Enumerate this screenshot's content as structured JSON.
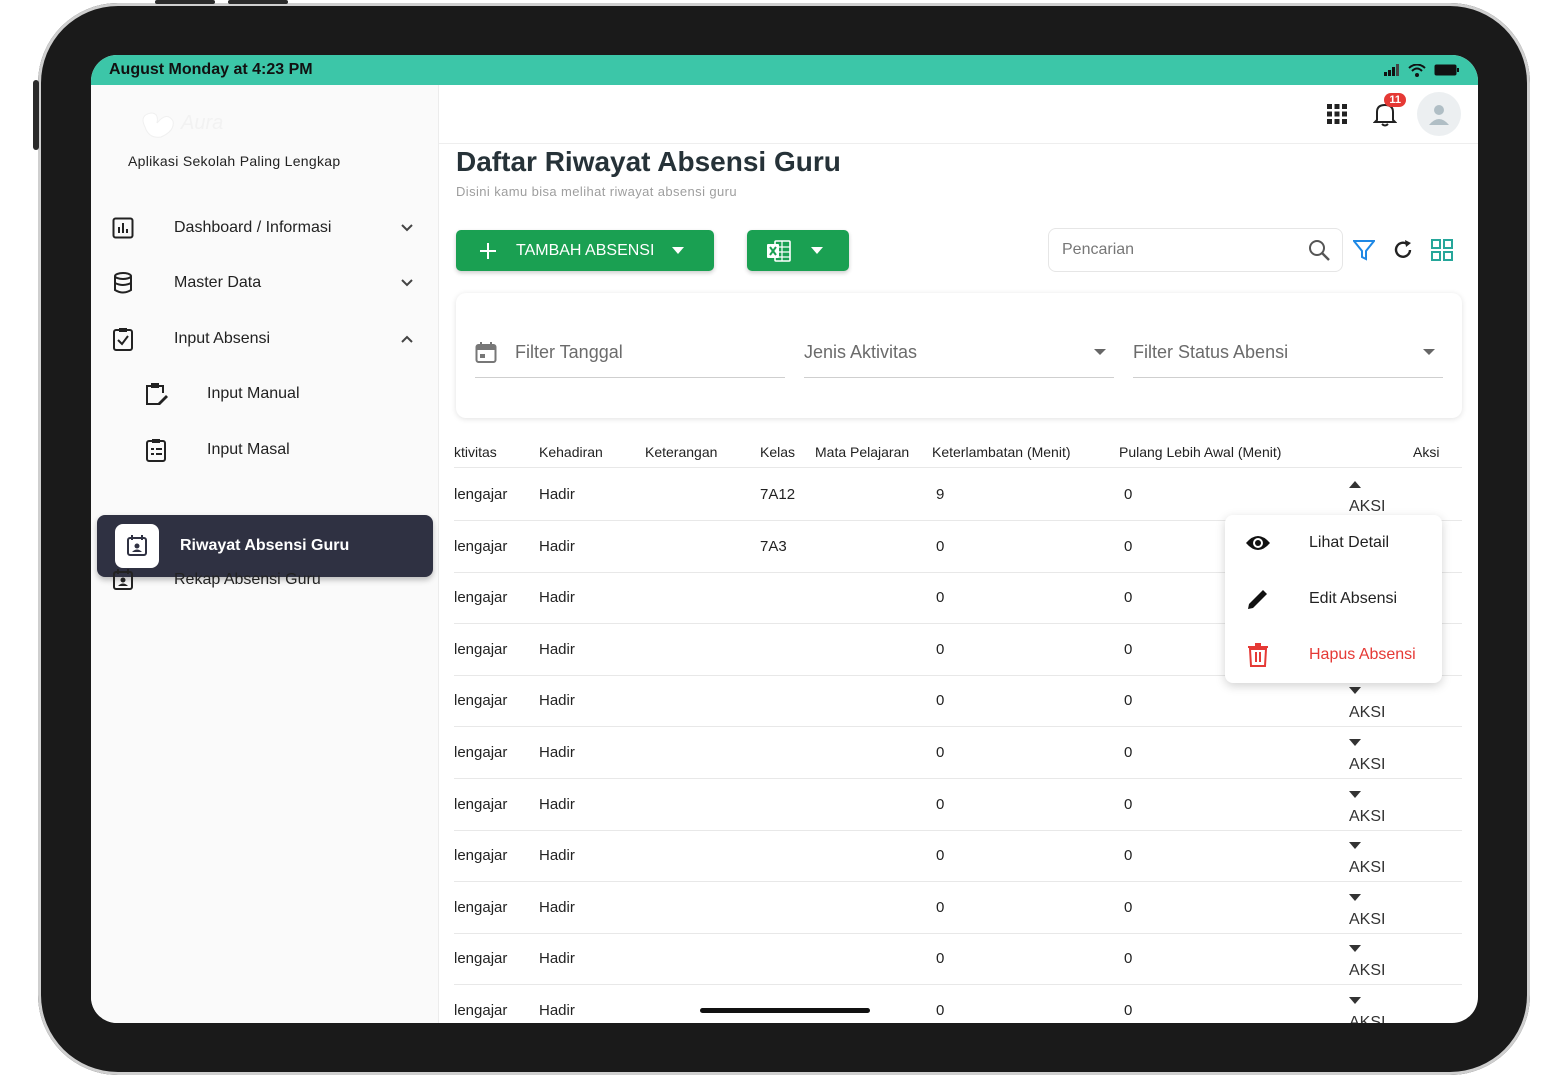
{
  "status_bar": {
    "time": "August Monday at 4:23 PM"
  },
  "brand": {
    "tagline": "Aplikasi Sekolah Paling Lengkap"
  },
  "sidebar": {
    "items": [
      {
        "label": "Dashboard / Informasi",
        "icon": "chart-icon"
      },
      {
        "label": "Master Data",
        "icon": "database-icon"
      },
      {
        "label": "Input Absensi",
        "icon": "clipboard-check-icon"
      },
      {
        "label": "Input Manual",
        "icon": "clipboard-edit-icon"
      },
      {
        "label": "Input Masal",
        "icon": "clipboard-list-icon"
      },
      {
        "label": "Riwayat Absensi Guru",
        "icon": "calendar-user-icon"
      },
      {
        "label": "Rekap Absensi Guru",
        "icon": "calendar-user-icon"
      }
    ]
  },
  "topbar": {
    "notification_count": "11"
  },
  "page": {
    "title": "Daftar Riwayat Absensi Guru",
    "subtitle": "Disini kamu bisa melihat riwayat absensi guru"
  },
  "toolbar": {
    "add_label": "TAMBAH ABSENSI",
    "search_placeholder": "Pencarian"
  },
  "filters": {
    "date": "Filter Tanggal",
    "activity": "Jenis Aktivitas",
    "status": "Filter Status Abensi"
  },
  "table": {
    "headers": [
      "ktivitas",
      "Kehadiran",
      "Keterangan",
      "Kelas",
      "Mata Pelajaran",
      "Keterlambatan (Menit)",
      "Pulang Lebih Awal (Menit)",
      "Aksi"
    ],
    "rows": [
      {
        "aktivitas": "lengajar",
        "kehadiran": "Hadir",
        "kelas": "7A12",
        "terlambat": "9",
        "pulang": "0",
        "aksi": "AKSI"
      },
      {
        "aktivitas": "lengajar",
        "kehadiran": "Hadir",
        "kelas": "7A3",
        "terlambat": "0",
        "pulang": "0",
        "aksi": ""
      },
      {
        "aktivitas": "lengajar",
        "kehadiran": "Hadir",
        "kelas": "",
        "terlambat": "0",
        "pulang": "0",
        "aksi": ""
      },
      {
        "aktivitas": "lengajar",
        "kehadiran": "Hadir",
        "kelas": "",
        "terlambat": "0",
        "pulang": "0",
        "aksi": ""
      },
      {
        "aktivitas": "lengajar",
        "kehadiran": "Hadir",
        "kelas": "",
        "terlambat": "0",
        "pulang": "0",
        "aksi": "AKSI"
      },
      {
        "aktivitas": "lengajar",
        "kehadiran": "Hadir",
        "kelas": "",
        "terlambat": "0",
        "pulang": "0",
        "aksi": "AKSI"
      },
      {
        "aktivitas": "lengajar",
        "kehadiran": "Hadir",
        "kelas": "",
        "terlambat": "0",
        "pulang": "0",
        "aksi": "AKSI"
      },
      {
        "aktivitas": "lengajar",
        "kehadiran": "Hadir",
        "kelas": "",
        "terlambat": "0",
        "pulang": "0",
        "aksi": "AKSI"
      },
      {
        "aktivitas": "lengajar",
        "kehadiran": "Hadir",
        "kelas": "",
        "terlambat": "0",
        "pulang": "0",
        "aksi": "AKSI"
      },
      {
        "aktivitas": "lengajar",
        "kehadiran": "Hadir",
        "kelas": "",
        "terlambat": "0",
        "pulang": "0",
        "aksi": "AKSI"
      },
      {
        "aktivitas": "lengajar",
        "kehadiran": "Hadir",
        "kelas": "",
        "terlambat": "0",
        "pulang": "0",
        "aksi": "AKSI"
      }
    ]
  },
  "action_menu": {
    "items": [
      {
        "label": "Lihat Detail",
        "icon": "eye-icon"
      },
      {
        "label": "Edit Absensi",
        "icon": "pencil-icon"
      },
      {
        "label": "Hapus Absensi",
        "icon": "trash-icon"
      }
    ]
  },
  "colors": {
    "status_bar": "#3cc6a8",
    "primary_green": "#1aa052",
    "active_nav": "#2f3142",
    "danger": "#e53935",
    "accent_blue": "#1e88e5",
    "accent_teal": "#26a69a"
  }
}
